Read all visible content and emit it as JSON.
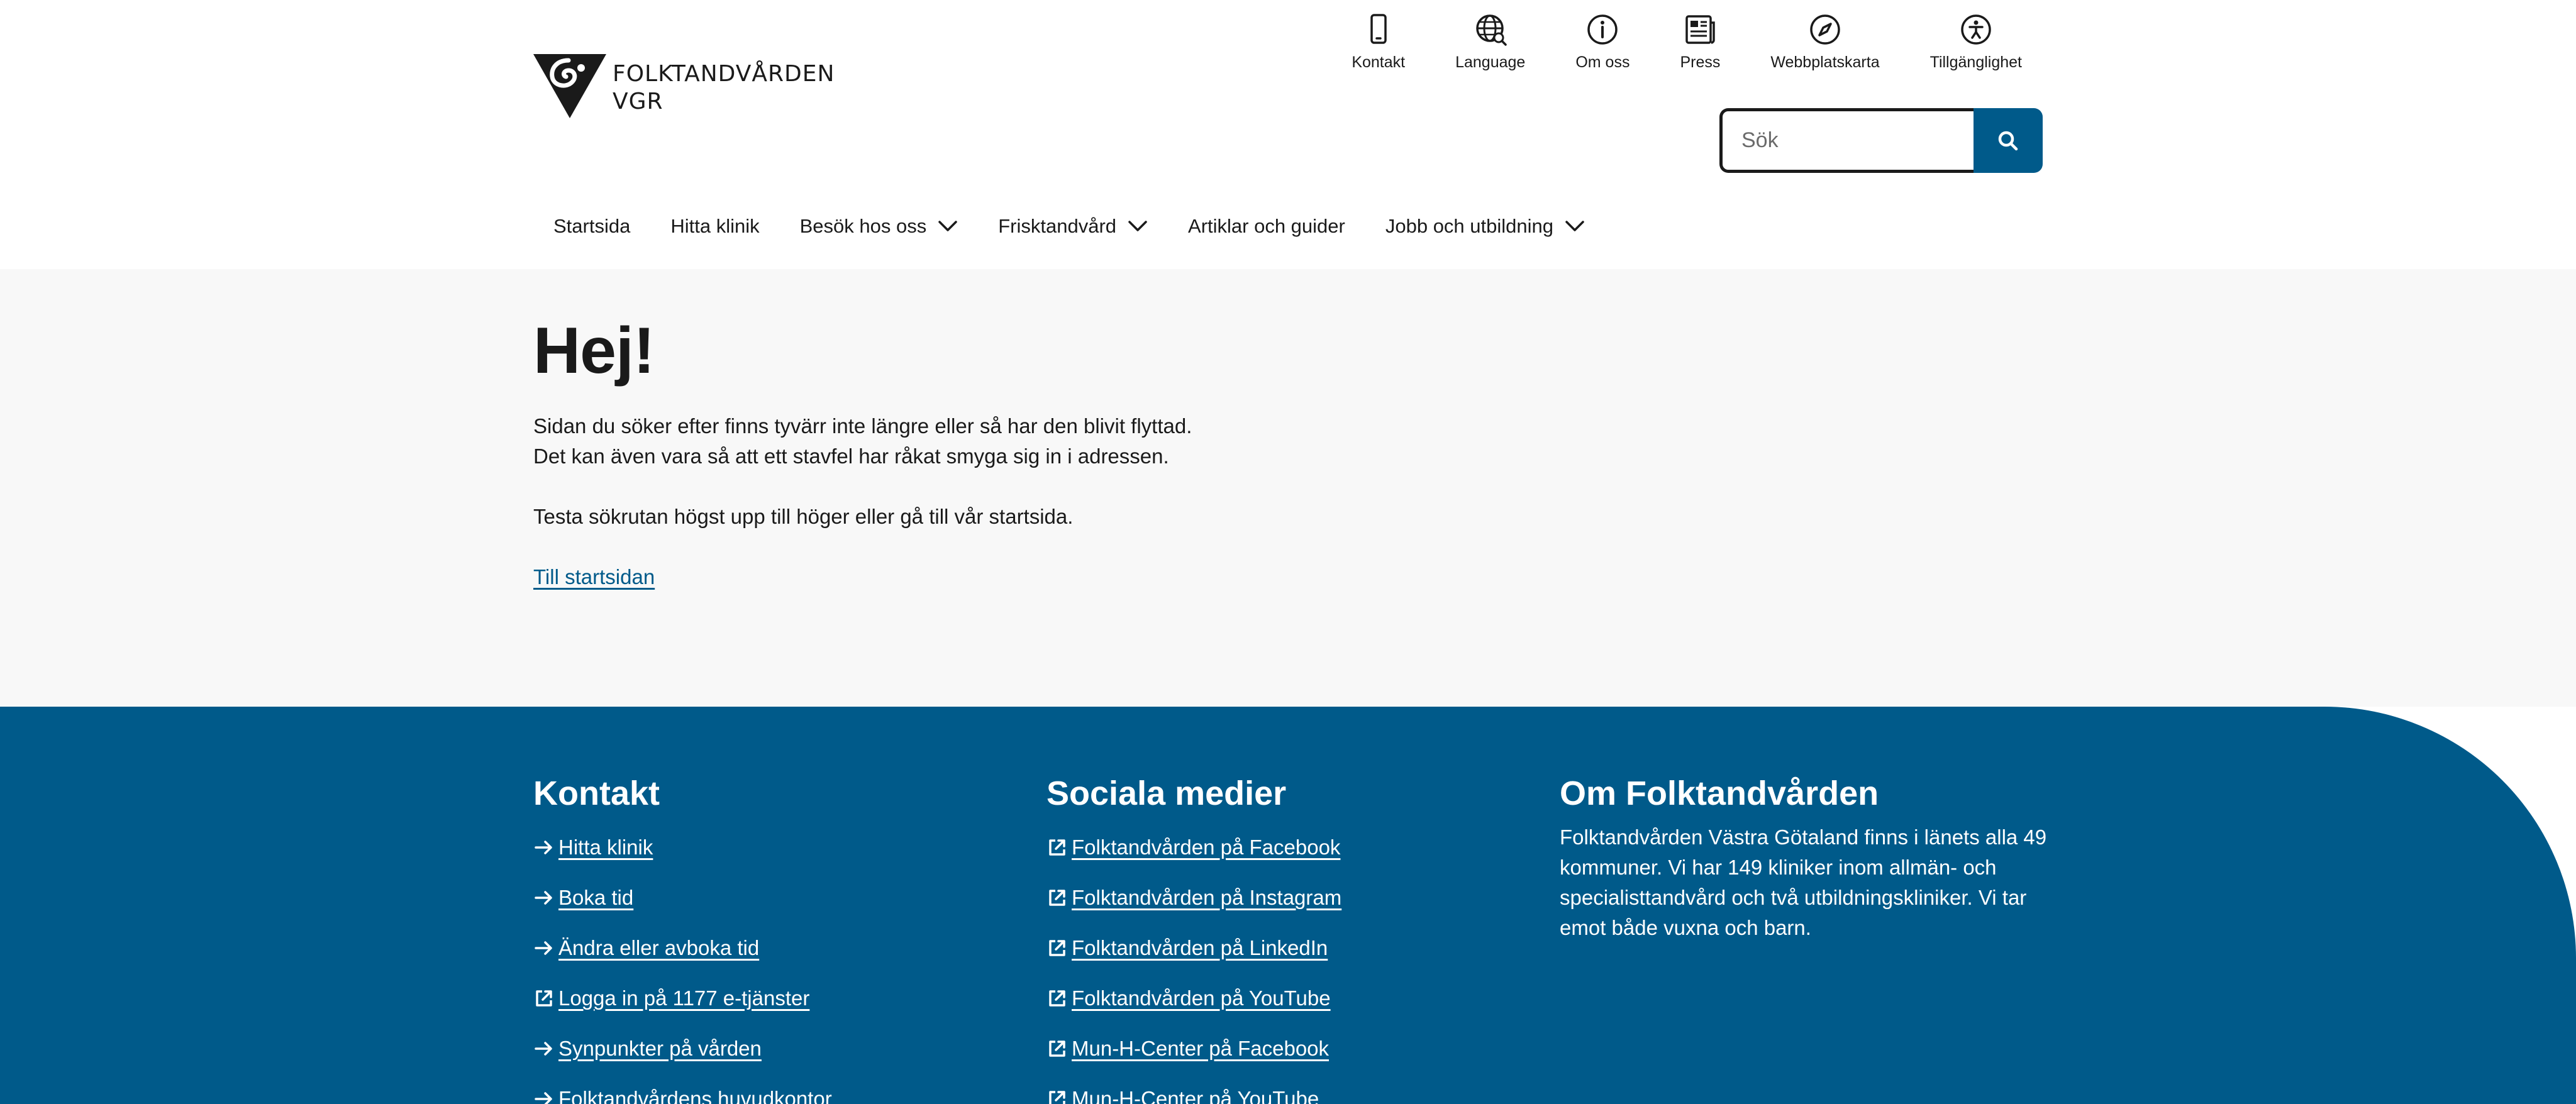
{
  "header": {
    "logo": {
      "line1": "FOLKTANDVÅRDEN",
      "line2": "VGR"
    },
    "utility": [
      {
        "label": "Kontakt",
        "icon": "phone-icon"
      },
      {
        "label": "Language",
        "icon": "globe-icon"
      },
      {
        "label": "Om oss",
        "icon": "info-icon"
      },
      {
        "label": "Press",
        "icon": "newspaper-icon"
      },
      {
        "label": "Webbplatskarta",
        "icon": "compass-icon"
      },
      {
        "label": "Tillgänglighet",
        "icon": "accessibility-icon"
      }
    ],
    "search": {
      "placeholder": "Sök",
      "value": ""
    },
    "nav": [
      {
        "label": "Startsida",
        "has_dropdown": false
      },
      {
        "label": "Hitta klinik",
        "has_dropdown": false
      },
      {
        "label": "Besök hos oss",
        "has_dropdown": true
      },
      {
        "label": "Frisktandvård",
        "has_dropdown": true
      },
      {
        "label": "Artiklar och guider",
        "has_dropdown": false
      },
      {
        "label": "Jobb och utbildning",
        "has_dropdown": true
      }
    ]
  },
  "main": {
    "title": "Hej!",
    "paragraph_1": "Sidan du söker efter finns tyvärr inte längre eller så har den blivit flyttad.",
    "paragraph_2": "Det kan även vara så att ett stavfel har råkat smyga sig in i adressen.",
    "paragraph_3": "Testa sökrutan högst upp till höger eller gå till vår startsida.",
    "home_link": "Till startsidan"
  },
  "footer": {
    "contact": {
      "title": "Kontakt",
      "links": [
        {
          "label": "Hitta klinik",
          "icon": "arrow-right-icon"
        },
        {
          "label": "Boka tid",
          "icon": "arrow-right-icon"
        },
        {
          "label": "Ändra eller avboka tid",
          "icon": "arrow-right-icon"
        },
        {
          "label": "Logga in på 1177 e-tjänster",
          "icon": "external-link-icon"
        },
        {
          "label": "Synpunkter på vården",
          "icon": "arrow-right-icon"
        },
        {
          "label": "Folktandvårdens huvudkontor",
          "icon": "arrow-right-icon"
        }
      ]
    },
    "social": {
      "title": "Sociala medier",
      "links": [
        {
          "label": "Folktandvården på Facebook",
          "icon": "external-link-icon"
        },
        {
          "label": "Folktandvården på Instagram",
          "icon": "external-link-icon"
        },
        {
          "label": "Folktandvården på LinkedIn",
          "icon": "external-link-icon"
        },
        {
          "label": "Folktandvården på YouTube",
          "icon": "external-link-icon"
        },
        {
          "label": "Mun-H-Center på Facebook",
          "icon": "external-link-icon"
        },
        {
          "label": "Mun-H-Center på YouTube",
          "icon": "external-link-icon"
        }
      ]
    },
    "about": {
      "title": "Om Folktandvården",
      "text": "Folktandvården Västra Götaland finns i länets alla 49 kommuner. Vi har 149 kliniker inom allmän- och specialisttandvård och två utbildningskliniker. Vi tar emot både vuxna och barn."
    }
  },
  "colors": {
    "brand_blue": "#005a8a",
    "main_bg": "#f8f8f8",
    "text": "#1a1a1a"
  }
}
